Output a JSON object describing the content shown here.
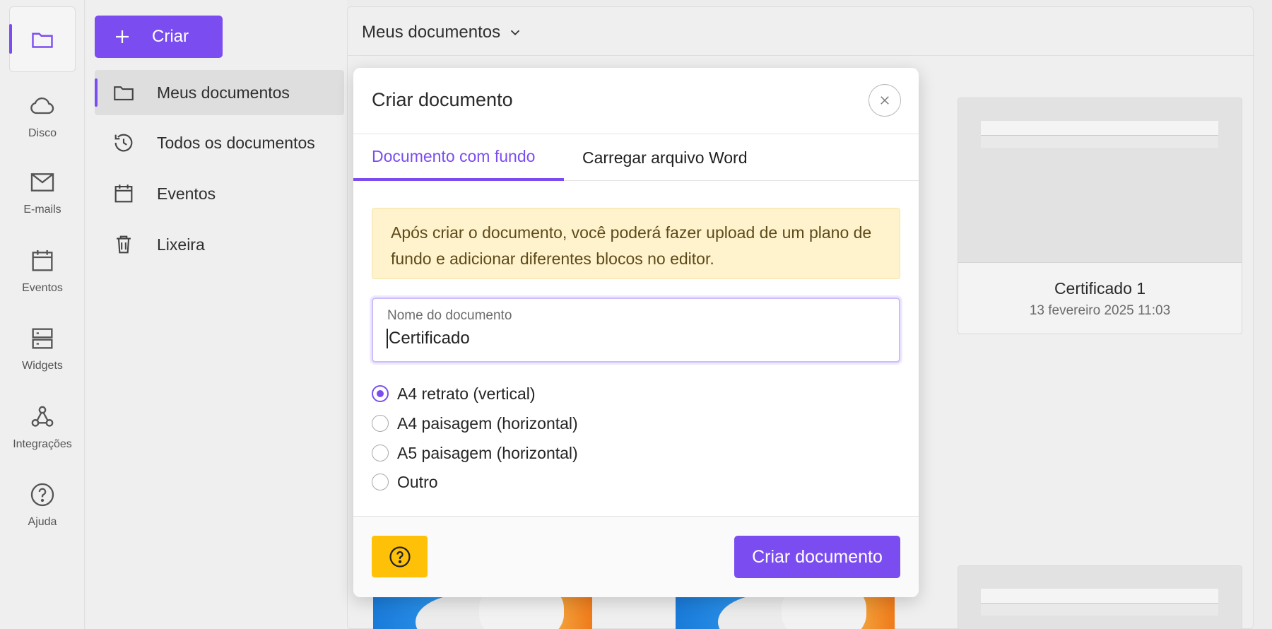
{
  "rail": {
    "items": [
      {
        "icon": "folder-icon",
        "label": ""
      },
      {
        "icon": "cloud-icon",
        "label": "Disco"
      },
      {
        "icon": "mail-icon",
        "label": "E-mails"
      },
      {
        "icon": "calendar-icon",
        "label": "Eventos"
      },
      {
        "icon": "widgets-icon",
        "label": "Widgets"
      },
      {
        "icon": "webhook-icon",
        "label": "Integrações"
      },
      {
        "icon": "help-icon",
        "label": "Ajuda"
      }
    ]
  },
  "sidebar": {
    "create_label": "Criar",
    "items": [
      {
        "label": "Meus documentos",
        "icon": "folder-icon",
        "active": true
      },
      {
        "label": "Todos os documentos",
        "icon": "history-icon"
      },
      {
        "label": "Eventos",
        "icon": "calendar-icon"
      },
      {
        "label": "Lixeira",
        "icon": "trash-icon"
      }
    ]
  },
  "main": {
    "folder_label": "Meus documentos",
    "cards": [
      {
        "title": "Certificado 1",
        "date": "13 fevereiro 2025 11:03"
      }
    ]
  },
  "dialog": {
    "title": "Criar documento",
    "tabs": [
      {
        "label": "Documento com fundo",
        "active": true
      },
      {
        "label": "Carregar arquivo Word"
      }
    ],
    "notice": "Após criar o documento, você poderá fazer upload de um plano de fundo e adicionar diferentes blocos no editor.",
    "name_field": {
      "label": "Nome do documento",
      "value": "Certificado"
    },
    "formats": [
      {
        "label": "A4 retrato (vertical)",
        "checked": true
      },
      {
        "label": "A4 paisagem (horizontal)"
      },
      {
        "label": "A5 paisagem (horizontal)"
      },
      {
        "label": "Outro"
      }
    ],
    "submit_label": "Criar documento"
  },
  "colors": {
    "accent": "#7b4df0",
    "warning": "#ffc107",
    "notice_bg": "#fff3cd"
  }
}
